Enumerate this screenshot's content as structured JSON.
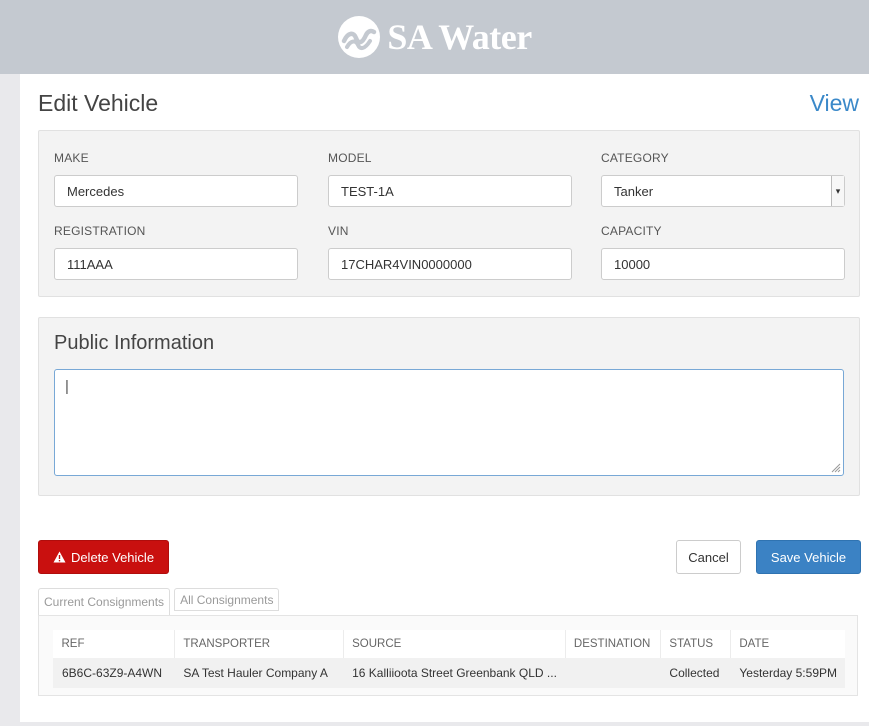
{
  "brand": {
    "name": "SA Water"
  },
  "page": {
    "title": "Edit Vehicle",
    "view_link": "View"
  },
  "vehicle": {
    "make": {
      "label": "MAKE",
      "value": "Mercedes"
    },
    "model": {
      "label": "MODEL",
      "value": "TEST-1A"
    },
    "category": {
      "label": "CATEGORY",
      "value": "Tanker"
    },
    "registration": {
      "label": "REGISTRATION",
      "value": "111AAA"
    },
    "vin": {
      "label": "VIN",
      "value": "17CHAR4VIN0000000"
    },
    "capacity": {
      "label": "CAPACITY",
      "value": "10000"
    }
  },
  "public_info": {
    "title": "Public Information",
    "value": "|"
  },
  "actions": {
    "delete": "Delete Vehicle",
    "cancel": "Cancel",
    "save": "Save Vehicle"
  },
  "tabs": [
    {
      "label": "Current Consignments",
      "active": true
    },
    {
      "label": "All Consignments",
      "active": false
    }
  ],
  "consignments": {
    "columns": [
      "REF",
      "TRANSPORTER",
      "SOURCE",
      "DESTINATION",
      "STATUS",
      "DATE"
    ],
    "rows": [
      [
        "6B6C-63Z9-A4WN",
        "SA Test Hauler Company A",
        "16 Kalliioota Street Greenbank QLD ...",
        "",
        "Collected",
        "Yesterday 5:59PM"
      ]
    ]
  },
  "colors": {
    "header": "#c4c9d0",
    "delete": "#c9100f",
    "save": "#3b82c4",
    "link": "#3b89c9"
  }
}
